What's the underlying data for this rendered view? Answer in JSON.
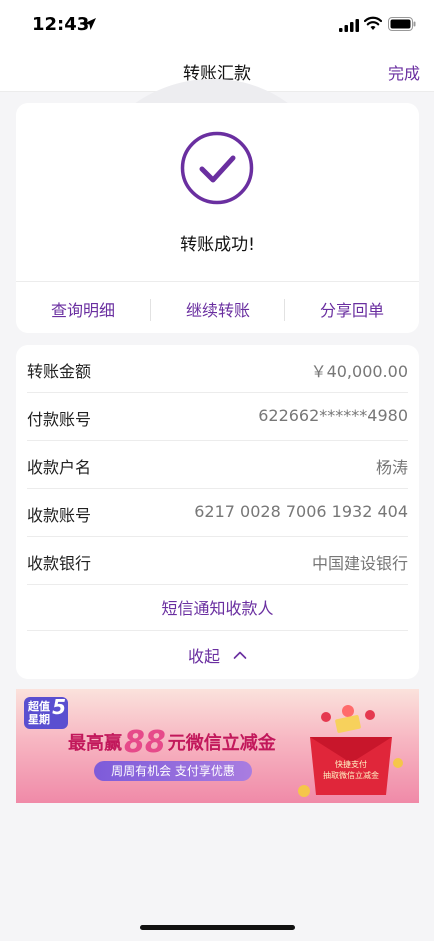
{
  "status_bar": {
    "time": "12:43"
  },
  "nav": {
    "title": "转账汇款",
    "done_label": "完成"
  },
  "result": {
    "message": "转账成功!",
    "actions": [
      "查询明细",
      "继续转账",
      "分享回单"
    ]
  },
  "details": {
    "rows": [
      {
        "label": "转账金额",
        "value": "￥40,000.00"
      },
      {
        "label": "付款账号",
        "value": "622662******4980"
      },
      {
        "label": "收款户名",
        "value": "杨涛"
      },
      {
        "label": "收款账号",
        "value": "6217 0028 7006 1932 404"
      },
      {
        "label": "收款银行",
        "value": "中国建设银行"
      }
    ],
    "sms_link": "短信通知收款人",
    "collapse_label": "收起"
  },
  "banner": {
    "logo_text": "超值\n星期",
    "logo_number": "5",
    "headline_prefix": "最高赢",
    "headline_amount": "88",
    "headline_suffix": "元微信立减金",
    "pill_text": "周周有机会  支付享优惠",
    "envelope_line1": "快捷支付",
    "envelope_line2": "抽取微信立减金"
  },
  "colors": {
    "accent": "#6a2fa0",
    "background": "#f5f5f7"
  },
  "icons": [
    "location-arrow-icon",
    "signal-icon",
    "wifi-icon",
    "battery-icon",
    "checkmark-circle-icon",
    "chevron-up-icon"
  ]
}
